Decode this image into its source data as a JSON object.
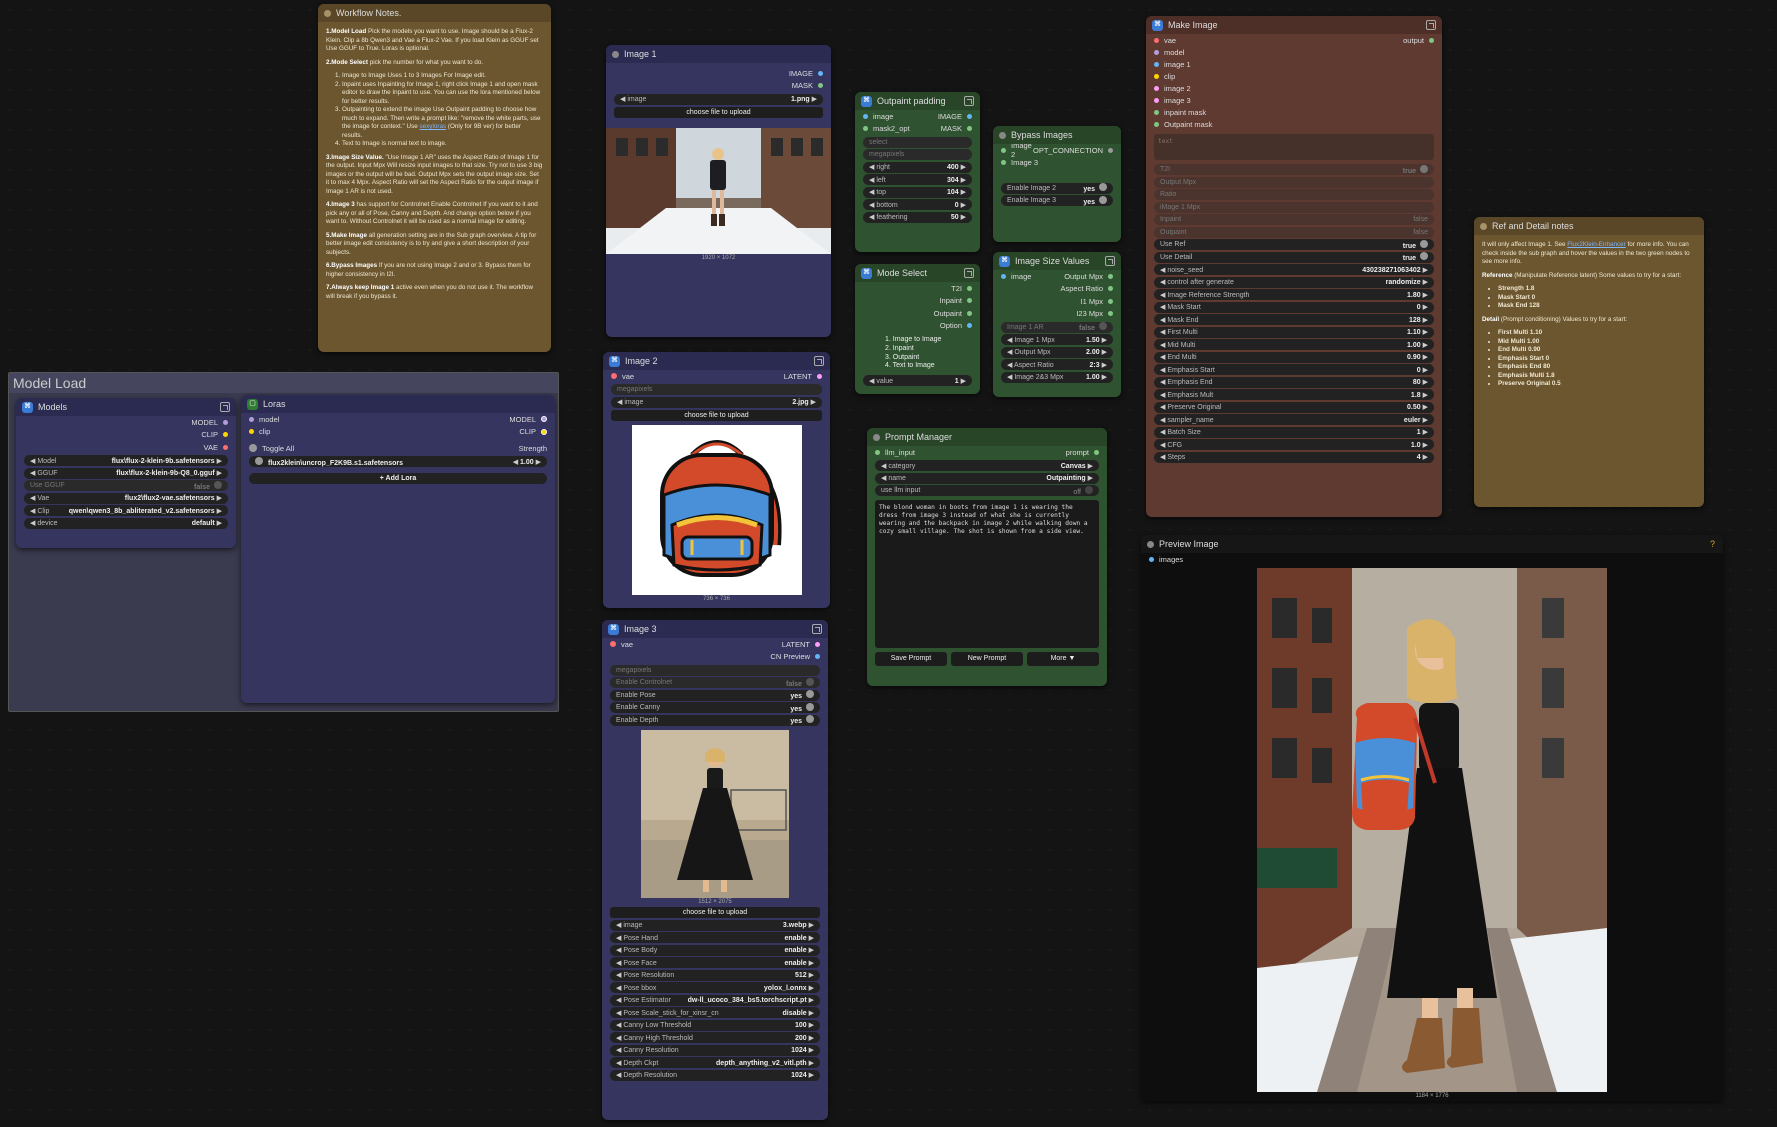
{
  "workflow_notes": {
    "title": "Workflow Notes.",
    "p1_head": "1.Model Load",
    "p1": " Pick the models you want to use. Image should be a Flux-2 Klein. Clip a 8b Qwen3 and Vae a Flux-2 Vae. If you load Klein as GGUF set Use GGUF to True. Loras is optional.",
    "p2_head": "2.Mode Select",
    "p2": " pick the number for what you want to do.",
    "p2_items": [
      "Image to Image Uses 1 to 3 Images For Image edit.",
      "Inpaint uses Inpainting for Image 1, right click Image 1 and open mask editor to draw the Inpaint to use. You can use the lora mentioned below for better results.",
      "Outpainting to extend the image Use Outpaint padding to choose how much to expand. Then write a prompt like: \"remove the white parts, use the image for context.\" Use",
      "Text to Image is normal text to image."
    ],
    "p2_link": "sexyloras",
    "p2_link_after": " (Only for 9B ver) for better results.",
    "p3_head": "3.Image Size Value.",
    "p3": " \"Use Image 1 AR\" uses the Aspect Ratio of Image 1 for the output. Input Mpx Will resize input images to that size. Try not to use 3 big images or the output will be bad. Output Mpx sets the output image size. Set it to max 4 Mpx. Aspect Ratio will set the Aspect Ratio for the output image if Image 1 AR is not used.",
    "p4_head": "4.Image 3",
    "p4": " has support for Controlnet Enable Controlnet If you want to it and pick any or all of Pose, Canny and Depth. And change option below if you want to. Without Controlnet it will be used as a normal image for editing.",
    "p5_head": "5.Make Image",
    "p5": " all generation setting are in the Sub graph overview. A tip for better image edit consistency is to try and give a short description of your subjects.",
    "p6_head": "6.Bypass Images",
    "p6": " If you are not using Image 2 and or 3. Bypass them for higher consistency in I2I.",
    "p7_head": "7.Always keep Image 1",
    "p7": " active even when you do not use it. The workflow will break if you bypass it."
  },
  "group": {
    "title": "Model Load"
  },
  "models": {
    "title": "Models",
    "outputs": [
      "MODEL",
      "CLIP",
      "VAE"
    ],
    "widgets": [
      {
        "label": "Model",
        "value": "flux\\flux-2-klein-9b.safetensors"
      },
      {
        "label": "GGUF",
        "value": "flux\\flux-2-klein-9b-Q8_0.gguf"
      },
      {
        "label": "Use GGUF",
        "value": "false"
      },
      {
        "label": "Vae",
        "value": "flux2\\flux2-vae.safetensors"
      },
      {
        "label": "Clip",
        "value": "qwen\\qwen3_8b_abliterated_v2.safetensors"
      },
      {
        "label": "device",
        "value": "default"
      }
    ]
  },
  "loras": {
    "title": "Loras",
    "inputs": [
      "model",
      "clip"
    ],
    "outputs": [
      "MODEL",
      "CLIP"
    ],
    "toggle_all": "Toggle All",
    "strength_label": "Strength",
    "lora_name": "flux2klein\\uncrop_F2K9B.s1.safetensors",
    "lora_strength": "1.00",
    "add_lora": "Add Lora"
  },
  "image1": {
    "title": "Image 1",
    "outputs": [
      "IMAGE",
      "MASK"
    ],
    "widget_label": "image",
    "widget_value": "1.png",
    "upload": "choose file to upload",
    "size": "1920 × 1072"
  },
  "image2": {
    "title": "Image 2",
    "input": "vae",
    "output": "LATENT",
    "dim_widget": "megapixels",
    "widget_label": "image",
    "widget_value": "2.jpg",
    "upload": "choose file to upload",
    "size": "736 × 736"
  },
  "image3": {
    "title": "Image 3",
    "input": "vae",
    "outputs": [
      "LATENT",
      "CN Preview"
    ],
    "dim_widget": "megapixels",
    "toggles": [
      {
        "label": "Enable Controlnet",
        "value": "false",
        "dim": true
      },
      {
        "label": "Enable Pose",
        "value": "yes",
        "dim": false
      },
      {
        "label": "Enable Canny",
        "value": "yes",
        "dim": false
      },
      {
        "label": "Enable Depth",
        "value": "yes",
        "dim": false
      }
    ],
    "size": "1512 × 2075",
    "upload": "choose file to upload",
    "widgets": [
      {
        "label": "image",
        "value": "3.webp"
      },
      {
        "label": "Pose Hand",
        "value": "enable"
      },
      {
        "label": "Pose Body",
        "value": "enable"
      },
      {
        "label": "Pose Face",
        "value": "enable"
      },
      {
        "label": "Pose Resolution",
        "value": "512"
      },
      {
        "label": "Pose bbox",
        "value": "yolox_l.onnx"
      },
      {
        "label": "Pose Estimator",
        "value": "dw-ll_ucoco_384_bs5.torchscript.pt"
      },
      {
        "label": "Pose Scale_stick_for_xinsr_cn",
        "value": "disable"
      },
      {
        "label": "Canny Low Threshold",
        "value": "100"
      },
      {
        "label": "Canny High Threshold",
        "value": "200"
      },
      {
        "label": "Canny Resolution",
        "value": "1024"
      },
      {
        "label": "Depth Ckpt",
        "value": "depth_anything_v2_vitl.pth"
      },
      {
        "label": "Depth Resolution",
        "value": "1024"
      }
    ]
  },
  "outpaint": {
    "title": "Outpaint padding",
    "io": [
      {
        "in": "image",
        "out": "IMAGE"
      },
      {
        "in": "mask2_opt",
        "out": "MASK"
      }
    ],
    "dim": [
      "select",
      "megapixels"
    ],
    "widgets": [
      {
        "label": "right",
        "value": "400"
      },
      {
        "label": "left",
        "value": "304"
      },
      {
        "label": "top",
        "value": "104"
      },
      {
        "label": "bottom",
        "value": "0"
      },
      {
        "label": "feathering",
        "value": "50"
      }
    ]
  },
  "bypass": {
    "title": "Bypass Images",
    "io": [
      {
        "in": "Image 2",
        "out": "OPT_CONNECTION"
      },
      {
        "in": "Image 3",
        "out": ""
      }
    ],
    "toggles": [
      {
        "label": "Enable Image 2",
        "value": "yes"
      },
      {
        "label": "Enable Image 3",
        "value": "yes"
      }
    ]
  },
  "mode_select": {
    "title": "Mode Select",
    "outputs": [
      "T2I",
      "Inpaint",
      "Outpaint",
      "Option"
    ],
    "list": [
      "1. Image to Image",
      "2. Inpaint",
      "3. Outpaint",
      "4. Text to Image"
    ],
    "value_label": "value",
    "value": "1"
  },
  "size_values": {
    "title": "Image Size Values",
    "input": "image",
    "outputs": [
      "Output Mpx",
      "Aspect Ratio",
      "I1 Mpx",
      "I23 Mpx"
    ],
    "widgets": [
      {
        "label": "Image 1 AR",
        "value": "false",
        "dim": true
      },
      {
        "label": "Image 1 Mpx",
        "value": "1.50",
        "dim": false
      },
      {
        "label": "Output Mpx",
        "value": "2.00",
        "dim": false
      },
      {
        "label": "Aspect Ratio",
        "value": "2:3",
        "dim": false
      },
      {
        "label": "Image 2&3 Mpx",
        "value": "1.00",
        "dim": false
      }
    ]
  },
  "prompt_manager": {
    "title": "Prompt Manager",
    "input": "llm_input",
    "output": "prompt",
    "widgets": [
      {
        "label": "category",
        "value": "Canvas"
      },
      {
        "label": "name",
        "value": "Outpainting"
      },
      {
        "label": "use llm input",
        "value": "off"
      }
    ],
    "text": "The blond woman in boots from image 1 is wearing the dress from image 3 instead of what she is currently wearing and the backpack in image 2 while walking down a cozy small village. The shot is shown from a side view.",
    "buttons": [
      "Save Prompt",
      "New Prompt",
      "More ▼"
    ]
  },
  "make_image": {
    "title": "Make Image",
    "inputs": [
      "vae",
      "model",
      "image 1",
      "clip",
      "image 2",
      "image 3",
      "inpaint mask",
      "Outpaint mask"
    ],
    "output": "output",
    "text_placeholder": "text",
    "dim_inputs": [
      {
        "label": "T2I",
        "value": "true"
      },
      {
        "label": "Output Mpx",
        "value": ""
      },
      {
        "label": "Ratio",
        "value": ""
      },
      {
        "label": "iMage 1 Mpx",
        "value": ""
      },
      {
        "label": "Inpaint",
        "value": "false"
      },
      {
        "label": "Outpaint",
        "value": "false"
      }
    ],
    "toggles": [
      {
        "label": "Use Ref",
        "value": "true"
      },
      {
        "label": "Use Detail",
        "value": "true"
      }
    ],
    "widgets": [
      {
        "label": "noise_seed",
        "value": "430238271063402"
      },
      {
        "label": "control after generate",
        "value": "randomize"
      },
      {
        "label": "Image Reference Strength",
        "value": "1.80"
      },
      {
        "label": "Mask Start",
        "value": "0"
      },
      {
        "label": "Mask End",
        "value": "128"
      },
      {
        "label": "First Multi",
        "value": "1.10"
      },
      {
        "label": "Mid Multi",
        "value": "1.00"
      },
      {
        "label": "End Multi",
        "value": "0.90"
      },
      {
        "label": "Emphasis Start",
        "value": "0"
      },
      {
        "label": "Emphasis End",
        "value": "80"
      },
      {
        "label": "Emphasis Mult",
        "value": "1.8"
      },
      {
        "label": "Preserve Original",
        "value": "0.50"
      },
      {
        "label": "sampler_name",
        "value": "euler"
      },
      {
        "label": "Batch Size",
        "value": "1"
      },
      {
        "label": "CFG",
        "value": "1.0"
      },
      {
        "label": "Steps",
        "value": "4"
      }
    ]
  },
  "ref_notes": {
    "title": "Ref and Detail notes",
    "p1_a": "It will only affect Image 1. See ",
    "p1_link": "Flux2Klein-Enhancer",
    "p1_b": " for more info. You can check inside the sub graph and hover the values in the two green nodes to see more info.",
    "p2_head": "Reference",
    "p2": " (Manipulate Reference latent) Some values to try for a start:",
    "p2_items": [
      "Strength 1.8",
      "Mask Start 0",
      "Mask End 128"
    ],
    "p3_head": "Detail",
    "p3": " (Prompt conditioning) Values to try for a start:",
    "p3_items": [
      "First Multi 1.10",
      "Mid Multi 1.00",
      "End Multi 0.90",
      "Emphasis Start 0",
      "Emphasis End 80",
      "Emphasis Multi 1.8",
      "Preserve Original 0.5"
    ]
  },
  "preview": {
    "title": "Preview Image",
    "input": "images",
    "help": "?",
    "size": "1184 × 1776"
  }
}
